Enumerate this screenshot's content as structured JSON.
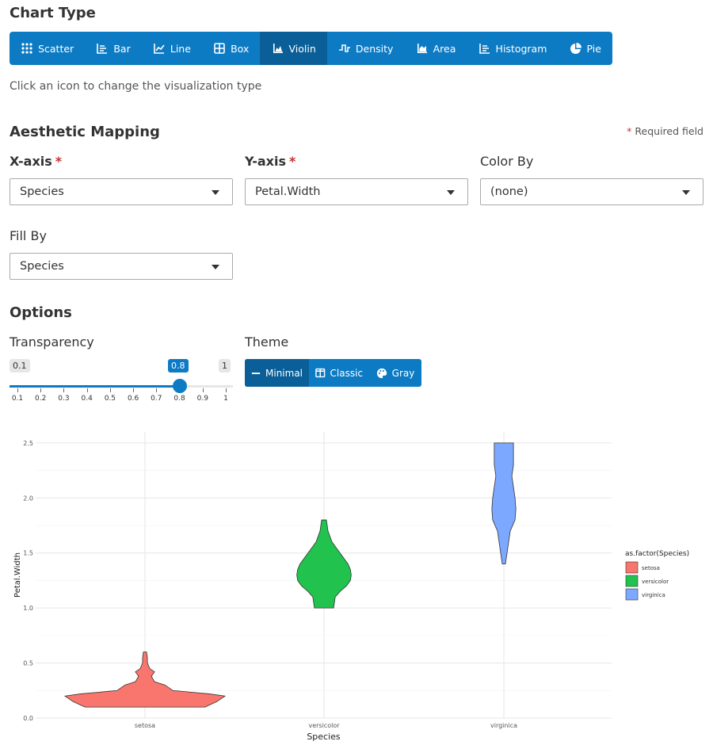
{
  "chart_type": {
    "heading": "Chart Type",
    "buttons": [
      {
        "label": "Scatter",
        "icon": "scatter-icon"
      },
      {
        "label": "Bar",
        "icon": "bar-icon"
      },
      {
        "label": "Line",
        "icon": "line-icon"
      },
      {
        "label": "Box",
        "icon": "box-icon"
      },
      {
        "label": "Violin",
        "icon": "violin-icon",
        "active": true
      },
      {
        "label": "Density",
        "icon": "density-icon"
      },
      {
        "label": "Area",
        "icon": "area-icon"
      },
      {
        "label": "Histogram",
        "icon": "histogram-icon"
      },
      {
        "label": "Pie",
        "icon": "pie-icon"
      }
    ],
    "hint": "Click an icon to change the visualization type"
  },
  "aesthetic": {
    "heading": "Aesthetic Mapping",
    "required_note": "Required field",
    "required_mark": "*",
    "x_label": "X-axis",
    "x_value": "Species",
    "y_label": "Y-axis",
    "y_value": "Petal.Width",
    "color_label": "Color By",
    "color_value": "(none)",
    "fill_label": "Fill By",
    "fill_value": "Species"
  },
  "options": {
    "heading": "Options",
    "transparency_label": "Transparency",
    "slider": {
      "min": "0.1",
      "max": "1",
      "value": "0.8",
      "value_num": 0.8,
      "ticks": [
        "0.1",
        "0.2",
        "0.3",
        "0.4",
        "0.5",
        "0.6",
        "0.7",
        "0.8",
        "0.9",
        "1"
      ]
    },
    "theme_label": "Theme",
    "themes": [
      {
        "label": "Minimal",
        "icon": "minus-icon",
        "active": true
      },
      {
        "label": "Classic",
        "icon": "columns-icon"
      },
      {
        "label": "Gray",
        "icon": "palette-icon"
      }
    ]
  },
  "chart_data": {
    "type": "violin",
    "xlabel": "Species",
    "ylabel": "Petal.Width",
    "categories": [
      "setosa",
      "versicolor",
      "virginica"
    ],
    "ylim": [
      0,
      2.6
    ],
    "yticks": [
      "0.0",
      "0.5",
      "1.0",
      "1.5",
      "2.0",
      "2.5"
    ],
    "legend_title": "as.factor(Species)",
    "legend_position": "right",
    "grid": true,
    "colors": {
      "setosa": "#f8766d",
      "versicolor": "#22c24f",
      "virginica": "#7ca9ff"
    },
    "series": [
      {
        "name": "setosa",
        "min": 0.1,
        "max": 0.6,
        "profile": [
          [
            0.1,
            0.75
          ],
          [
            0.15,
            0.9
          ],
          [
            0.2,
            1.0
          ],
          [
            0.22,
            0.8
          ],
          [
            0.25,
            0.35
          ],
          [
            0.3,
            0.25
          ],
          [
            0.33,
            0.12
          ],
          [
            0.38,
            0.08
          ],
          [
            0.42,
            0.12
          ],
          [
            0.45,
            0.06
          ],
          [
            0.5,
            0.03
          ],
          [
            0.55,
            0.03
          ],
          [
            0.6,
            0.02
          ]
        ]
      },
      {
        "name": "versicolor",
        "min": 1.0,
        "max": 1.8,
        "profile": [
          [
            1.0,
            0.12
          ],
          [
            1.1,
            0.14
          ],
          [
            1.15,
            0.2
          ],
          [
            1.2,
            0.28
          ],
          [
            1.25,
            0.33
          ],
          [
            1.3,
            0.34
          ],
          [
            1.35,
            0.33
          ],
          [
            1.4,
            0.3
          ],
          [
            1.5,
            0.2
          ],
          [
            1.6,
            0.1
          ],
          [
            1.7,
            0.05
          ],
          [
            1.8,
            0.03
          ]
        ]
      },
      {
        "name": "virginica",
        "min": 1.4,
        "max": 2.5,
        "profile": [
          [
            1.4,
            0.02
          ],
          [
            1.5,
            0.04
          ],
          [
            1.6,
            0.06
          ],
          [
            1.7,
            0.08
          ],
          [
            1.8,
            0.14
          ],
          [
            1.9,
            0.15
          ],
          [
            2.0,
            0.14
          ],
          [
            2.1,
            0.12
          ],
          [
            2.2,
            0.1
          ],
          [
            2.3,
            0.12
          ],
          [
            2.4,
            0.12
          ],
          [
            2.5,
            0.12
          ]
        ]
      }
    ]
  }
}
